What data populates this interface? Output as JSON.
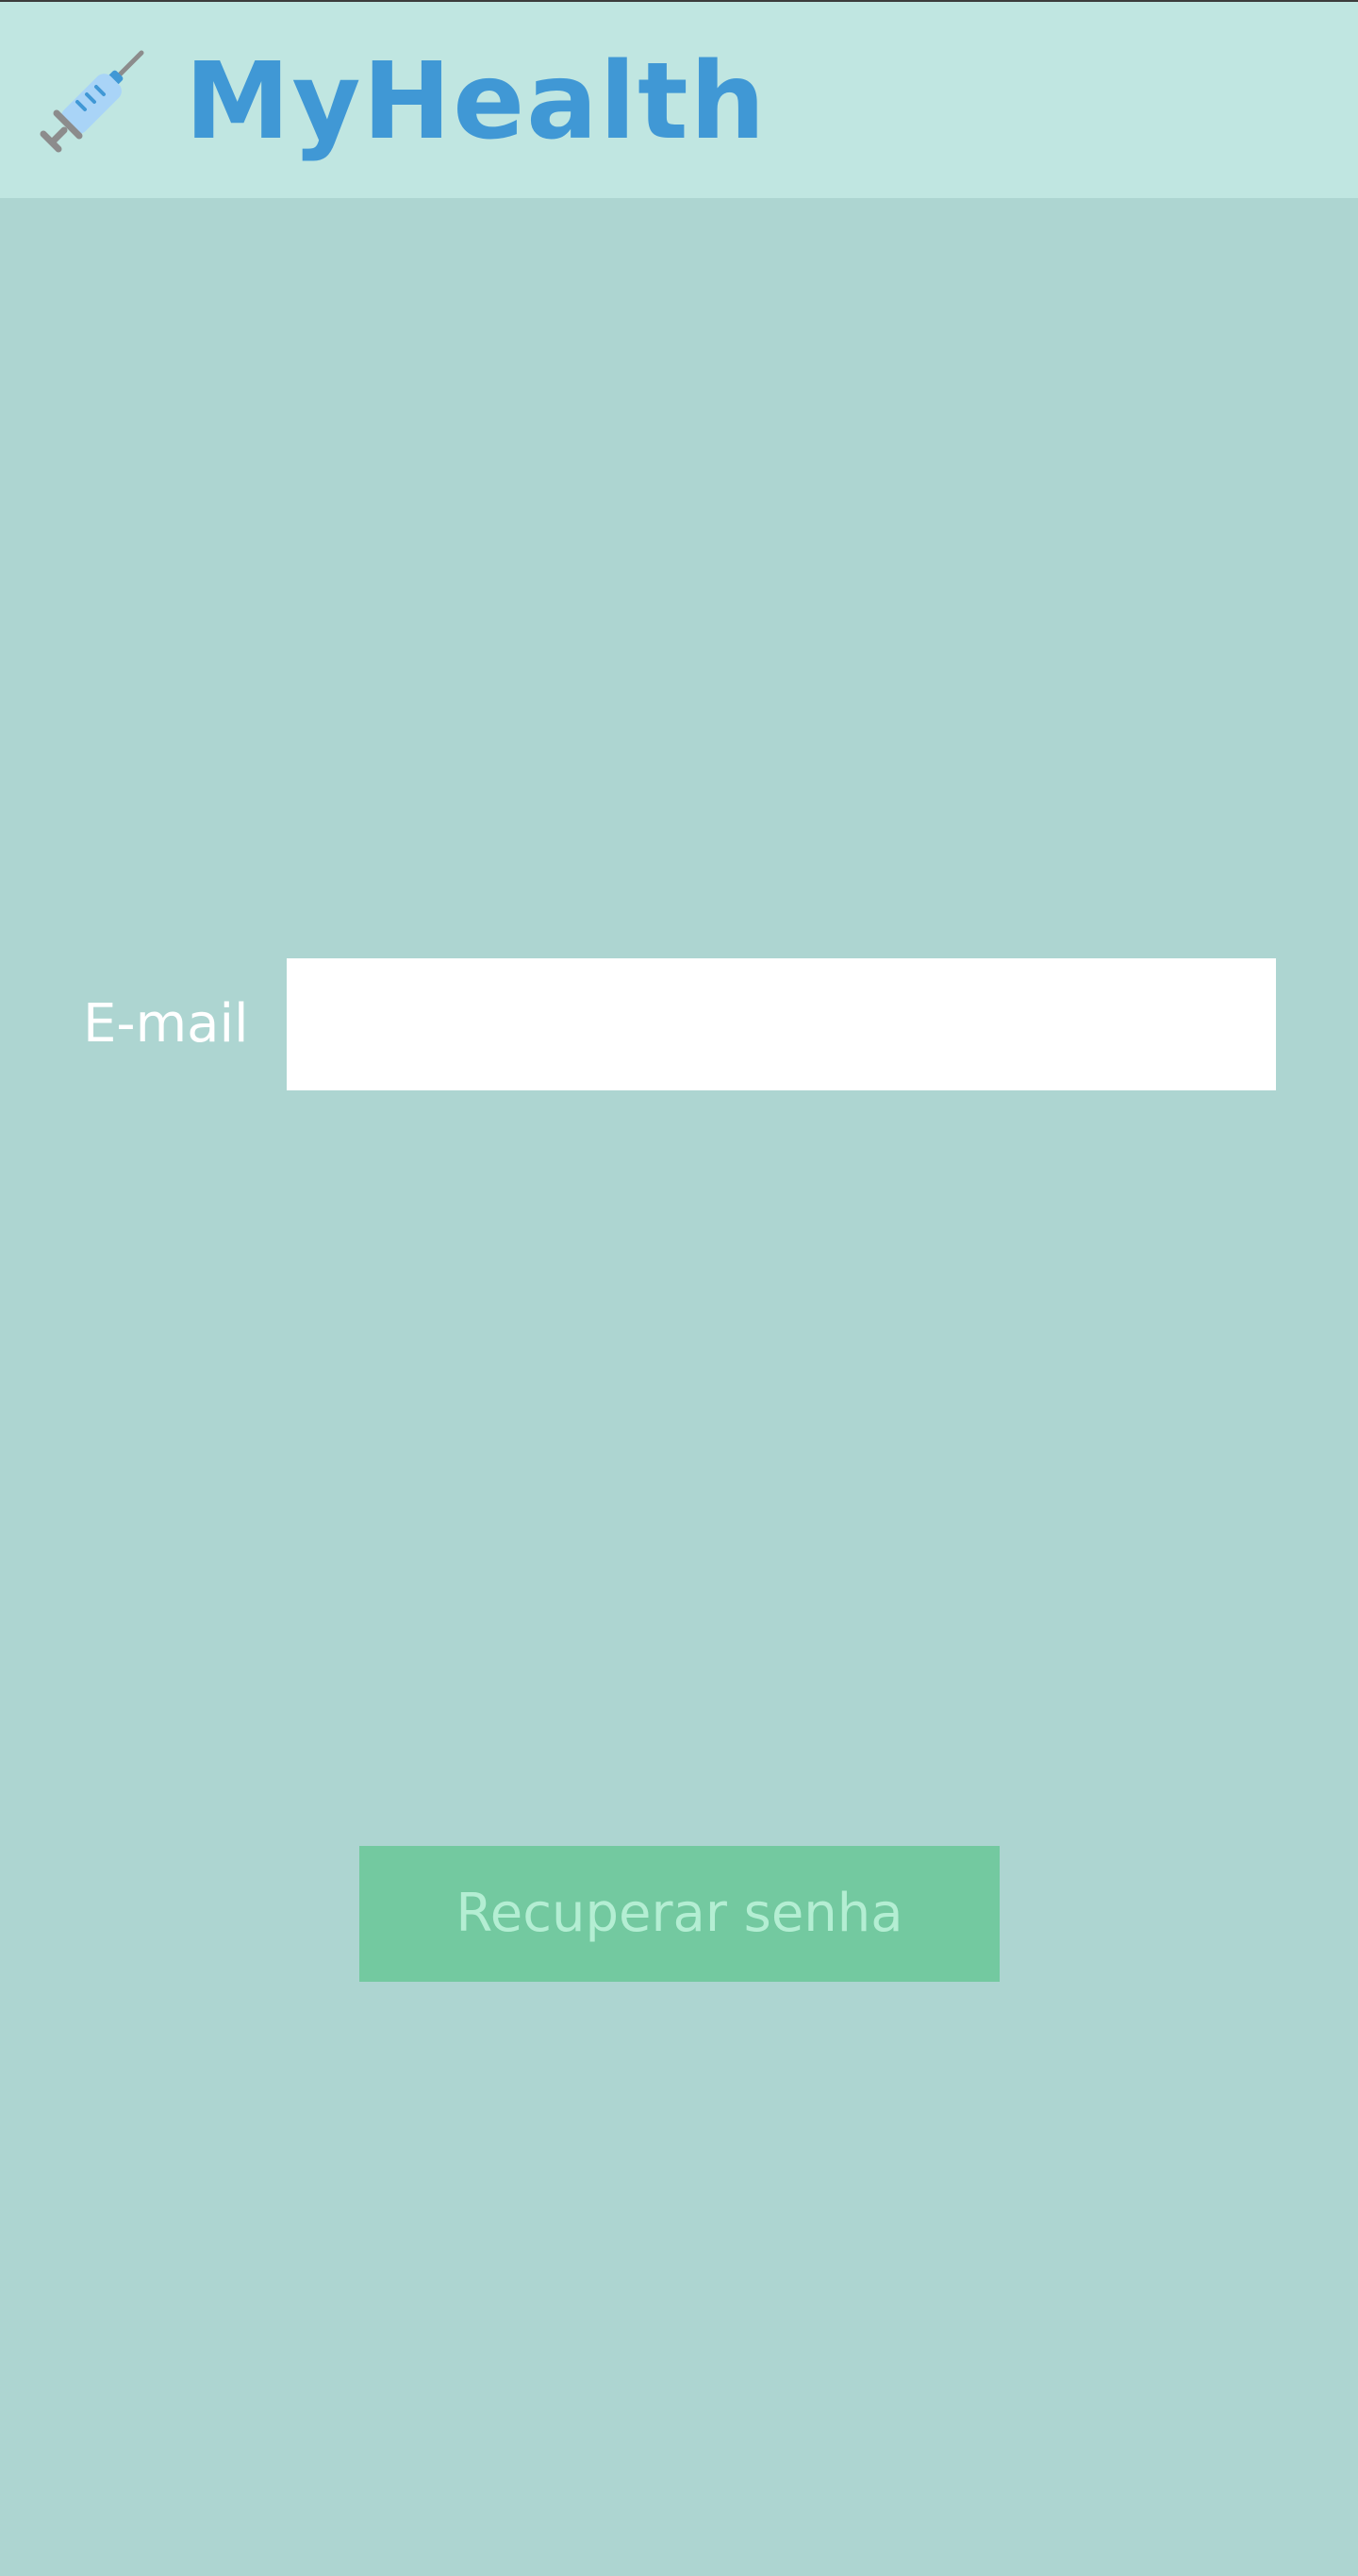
{
  "header": {
    "logo_icon": "syringe-icon",
    "title": "MyHealth"
  },
  "form": {
    "email_label": "E-mail",
    "email_value": "",
    "email_placeholder": ""
  },
  "actions": {
    "recover_label": "Recuperar senha"
  },
  "colors": {
    "background": "#add5d1",
    "header_background": "#c0e6e1",
    "title": "#4098d5",
    "button_background": "#73c9a0",
    "button_text": "#b4eed3",
    "label_text": "#ffffff"
  }
}
